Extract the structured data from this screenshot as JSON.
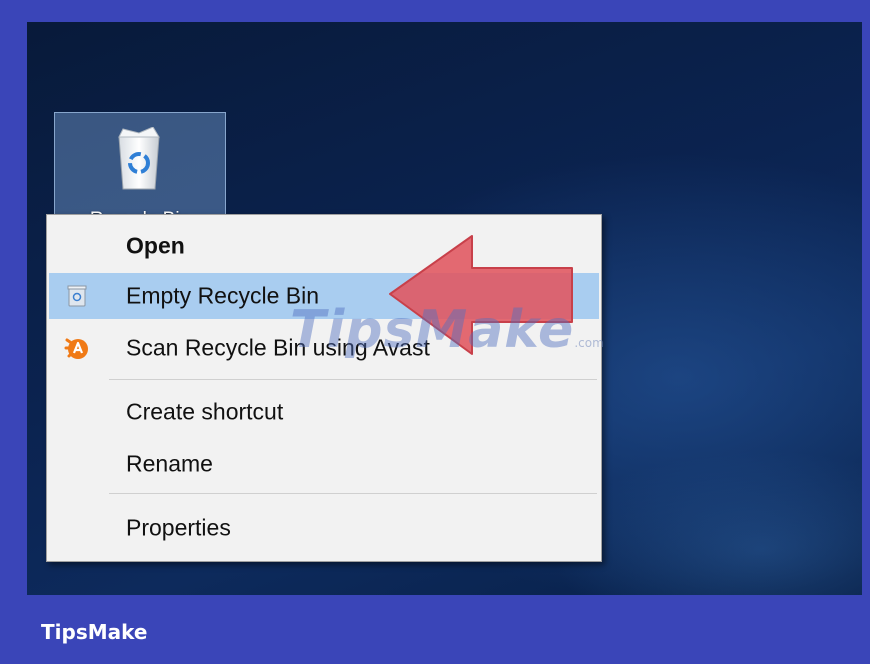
{
  "desktop": {
    "icon": {
      "label": "Recycle Bin",
      "icon_name": "recycle-bin-icon"
    }
  },
  "context_menu": {
    "items": [
      {
        "label": "Open",
        "bold": true,
        "icon": null
      },
      {
        "label": "Empty Recycle Bin",
        "highlighted": true,
        "icon": "recycle-bin-small-icon"
      },
      {
        "label": "Scan Recycle Bin using Avast",
        "icon": "avast-icon"
      },
      {
        "label": "Create shortcut",
        "icon": null
      },
      {
        "label": "Rename",
        "icon": null
      },
      {
        "label": "Properties",
        "icon": null
      }
    ],
    "highlight_color": "#a9cdf0"
  },
  "overlay": {
    "arrow_color": "#e0555f",
    "watermark": "TipsMake",
    "watermark_suffix": ".com"
  },
  "footer": {
    "brand": "TipsMake"
  },
  "colors": {
    "frame": "#3a45b8",
    "desktop": "#0b2350"
  }
}
